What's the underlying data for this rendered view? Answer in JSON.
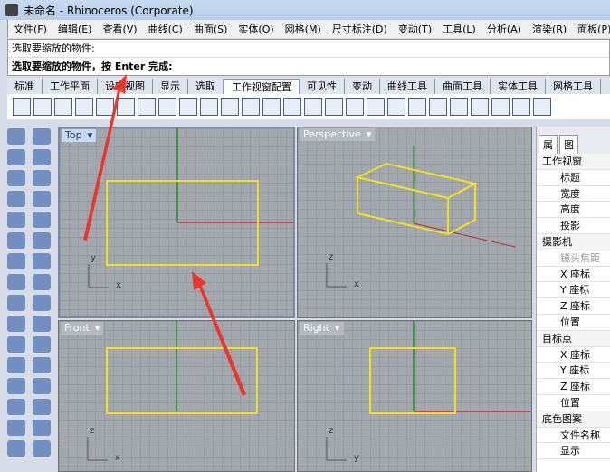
{
  "title": "未命名 - Rhinoceros (Corporate)",
  "menu": [
    "文件(F)",
    "编辑(E)",
    "查看(V)",
    "曲线(C)",
    "曲面(S)",
    "实体(O)",
    "网格(M)",
    "尺寸标注(D)",
    "变动(T)",
    "工具(L)",
    "分析(A)",
    "渲染(R)",
    "面板(P)"
  ],
  "command": {
    "history": "选取要缩放的物件:",
    "prompt": "选取要缩放的物件，按 Enter 完成:"
  },
  "tabs": [
    "标准",
    "工作平面",
    "设定视图",
    "显示",
    "选取",
    "工作视窗配置",
    "可见性",
    "变动",
    "曲线工具",
    "曲面工具",
    "实体工具",
    "网格工具"
  ],
  "active_tab": "工作视窗配置",
  "viewports": [
    {
      "name": "Top",
      "dropdown": "▾"
    },
    {
      "name": "Perspective",
      "dropdown": "▾"
    },
    {
      "name": "Front",
      "dropdown": "▾"
    },
    {
      "name": "Right",
      "dropdown": "▾"
    }
  ],
  "axes": {
    "x": "x",
    "y": "y",
    "z": "z"
  },
  "panel": {
    "tabs": [
      "属",
      "图"
    ],
    "rows": [
      {
        "t": "工作视窗",
        "k": "h"
      },
      {
        "t": "标题",
        "k": "s"
      },
      {
        "t": "宽度",
        "k": "s"
      },
      {
        "t": "高度",
        "k": "s"
      },
      {
        "t": "投影",
        "k": "s"
      },
      {
        "t": "摄影机",
        "k": "h"
      },
      {
        "t": "镜头焦距",
        "k": "s g"
      },
      {
        "t": "X 座标",
        "k": "s"
      },
      {
        "t": "Y 座标",
        "k": "s"
      },
      {
        "t": "Z 座标",
        "k": "s"
      },
      {
        "t": "位置",
        "k": "s"
      },
      {
        "t": "目标点",
        "k": "h"
      },
      {
        "t": "X 座标",
        "k": "s"
      },
      {
        "t": "Y 座标",
        "k": "s"
      },
      {
        "t": "Z 座标",
        "k": "s"
      },
      {
        "t": "位置",
        "k": "s"
      },
      {
        "t": "底色图案",
        "k": "h"
      },
      {
        "t": "文件名称",
        "k": "s"
      },
      {
        "t": "显示",
        "k": "s"
      }
    ]
  },
  "colors": {
    "object": "#f0e020",
    "x_axis": "#b03030",
    "y_axis": "#209020",
    "annotation": "#e8382c"
  }
}
